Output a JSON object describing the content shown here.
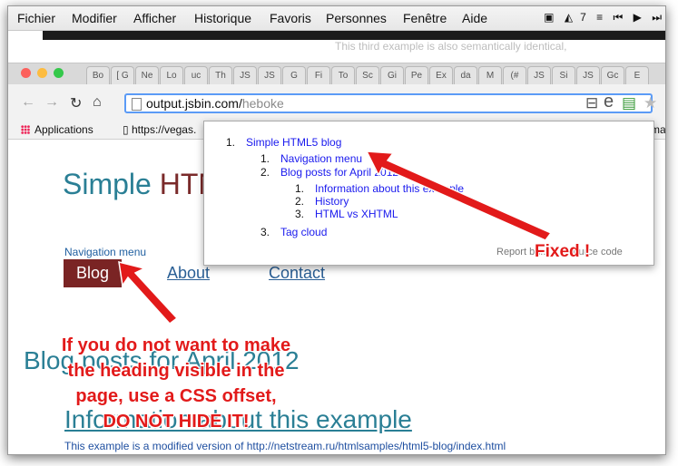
{
  "menubar": {
    "items": [
      "Fichier",
      "Modifier",
      "Afficher",
      "Historique",
      "Favoris",
      "Personnes",
      "Fenêtre",
      "Aide"
    ],
    "status_number": "7"
  },
  "background_note": "This third example is also semantically identical,",
  "tabs": [
    "Bo",
    "[ G",
    "Ne",
    "Lo",
    "uc",
    "Th",
    "JS",
    "JS",
    "G",
    "Fi",
    "To",
    "Sc",
    "Gi",
    "Pe",
    "Ex",
    "da",
    "M",
    "(#",
    "JS",
    "Si",
    "JS",
    "Gc",
    "E"
  ],
  "toolbar": {
    "url_host": "output.jsbin.com/",
    "url_path": "heboke"
  },
  "bookmarks": {
    "apps_label": "Applications",
    "item1": "https://vegas.",
    "item_right": "ma"
  },
  "page": {
    "title_part1": "Simple ",
    "title_part2": "HTM",
    "nav_label": "Navigation menu",
    "nav_items": [
      "Blog",
      "About",
      "Contact"
    ],
    "heading2": "Blog posts for April 2012",
    "heading3": "Information about this example",
    "footnote": "This example is a modified version of http://netstream.ru/htmlsamples/html5-blog/index.html"
  },
  "outline": {
    "items": [
      {
        "num": "1.",
        "label": "Simple HTML5 blog"
      },
      {
        "num": "1.",
        "label": "Navigation menu"
      },
      {
        "num": "2.",
        "label": "Blog posts for April 2012"
      },
      {
        "num": "1.",
        "label": "Information about this example"
      },
      {
        "num": "2.",
        "label": "History"
      },
      {
        "num": "3.",
        "label": "HTML vs XHTML"
      },
      {
        "num": "3.",
        "label": "Tag cloud"
      }
    ],
    "footer": "Report bu... d... source code"
  },
  "annotations": {
    "fixed": "Fixed !",
    "advice_lines": [
      "If you do not want to make",
      "the heading visible in the",
      "page, use a CSS offset,",
      "DO NOT HIDE IT!"
    ]
  },
  "colors": {
    "annotation": "#e21a1a",
    "title_teal": "#2a7f95",
    "nav_dark_red": "#7a2424",
    "link_blue": "#1a1aee"
  }
}
